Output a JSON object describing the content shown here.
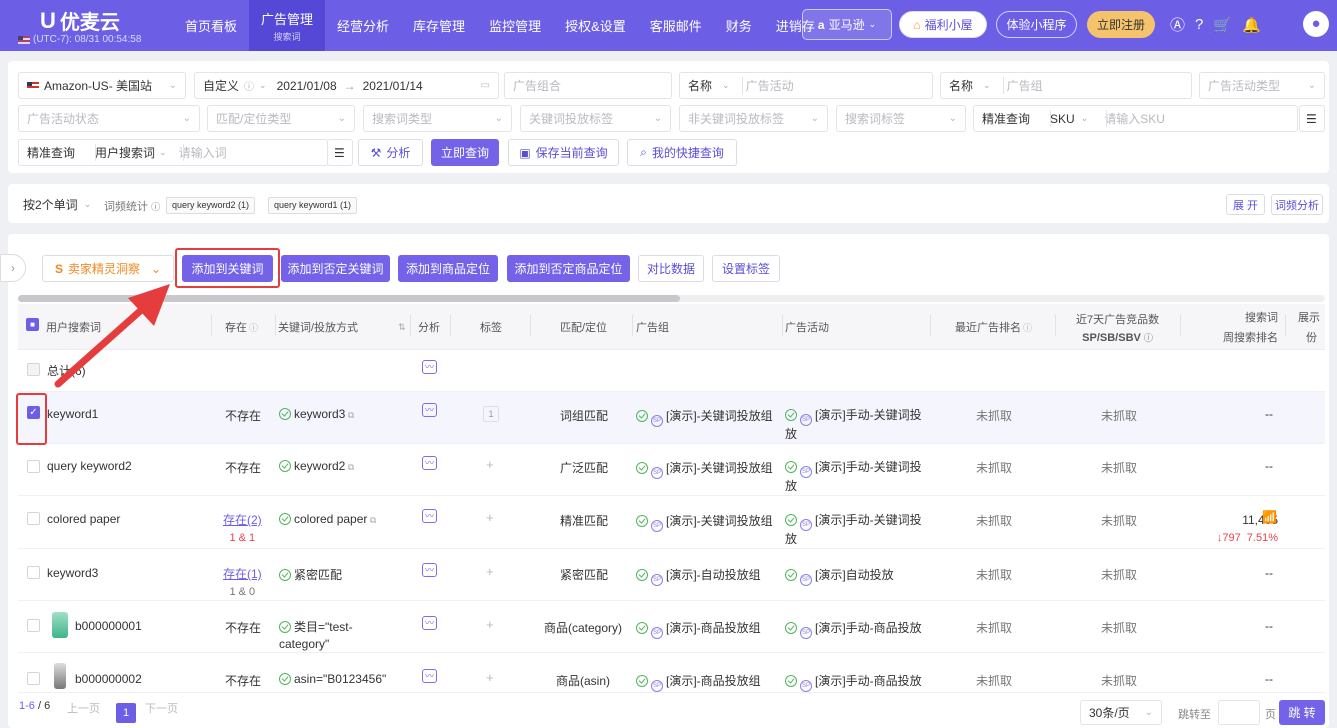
{
  "app": {
    "logo": "优麦云",
    "timezone": "(UTC-7): 08/31 00:54:58"
  },
  "nav": [
    {
      "label": "首页看板",
      "sub": ""
    },
    {
      "label": "广告管理",
      "sub": "搜索词"
    },
    {
      "label": "经营分析",
      "sub": ""
    },
    {
      "label": "库存管理",
      "sub": ""
    },
    {
      "label": "监控管理",
      "sub": ""
    },
    {
      "label": "授权&设置",
      "sub": ""
    },
    {
      "label": "客服邮件",
      "sub": ""
    },
    {
      "label": "财务",
      "sub": ""
    },
    {
      "label": "进销存",
      "sub": ""
    }
  ],
  "topright": {
    "platform": "亚马逊",
    "fuli": "福利小屋",
    "tiyan": "体验小程序",
    "register": "立即注册"
  },
  "filters": {
    "site": "Amazon-US- 美国站",
    "date_mode": "自定义",
    "date_start": "2021/01/08",
    "date_end": "2021/01/14",
    "ad_combo": "广告组合",
    "name1": "名称",
    "ad_campaign": "广告活动",
    "name2": "名称",
    "ad_group": "广告组",
    "campaign_type": "广告活动类型",
    "campaign_status": "广告活动状态",
    "match_type": "匹配/定位类型",
    "search_term_type": "搜索词类型",
    "kw_tag": "关键词投放标签",
    "non_kw_tag": "非关键词投放标签",
    "st_tag": "搜索词标签",
    "exact1": "精准查询",
    "sku": "SKU",
    "sku_placeholder": "请输入SKU",
    "exact2": "精准查询",
    "user_st": "用户搜索词",
    "term_placeholder": "请输入词",
    "analyze": "分析",
    "query_now": "立即查询",
    "save_query": "保存当前查询",
    "my_query": "我的快捷查询"
  },
  "wordstats": {
    "group_by": "按2个单词",
    "label": "词频统计",
    "tags": [
      "query keyword2 (1)",
      "query keyword1 (1)"
    ],
    "expand": "展 开",
    "analysis": "词频分析"
  },
  "actions": {
    "insight": "卖家精灵洞察",
    "add_kw": "添加到关键词",
    "add_neg_kw": "添加到否定关键词",
    "add_product": "添加到商品定位",
    "add_neg_product": "添加到否定商品定位",
    "compare": "对比数据",
    "set_tag": "设置标签"
  },
  "columns": {
    "term": "用户搜索词",
    "exists": "存在",
    "kw": "关键词/投放方式",
    "analysis": "分析",
    "tag": "标签",
    "match": "匹配/定位",
    "adgroup": "广告组",
    "campaign": "广告活动",
    "rank": "最近广告排名",
    "comp_a": "近7天广告竞品数",
    "comp_b": "SP/SB/SBV",
    "weekly_a": "搜索词",
    "weekly_b": "周搜索排名",
    "show_a": "展示",
    "show_b": "份"
  },
  "total_label": "总计(6)",
  "rows": [
    {
      "term": "keyword1",
      "exists": "不存在",
      "exists_sub": "",
      "kw": "keyword3",
      "tag": "1",
      "match": "词组匹配",
      "adgroup": "[演示]-关键词投放组",
      "campaign_1": "[演示]手动-关键词投",
      "campaign_2": "放",
      "rank": "未抓取",
      "comp": "未抓取",
      "weekly": "--",
      "weekly_sub": ""
    },
    {
      "term": "query keyword2",
      "exists": "不存在",
      "exists_sub": "",
      "kw": "keyword2",
      "tag": "+",
      "match": "广泛匹配",
      "adgroup": "[演示]-关键词投放组",
      "campaign_1": "[演示]手动-关键词投",
      "campaign_2": "放",
      "rank": "未抓取",
      "comp": "未抓取",
      "weekly": "--",
      "weekly_sub": ""
    },
    {
      "term": "colored paper",
      "exists": "存在(2)",
      "exists_sub": "1 & 1",
      "kw": "colored paper",
      "tag": "+",
      "match": "精准匹配",
      "adgroup": "[演示]-关键词投放组",
      "campaign_1": "[演示]手动-关键词投",
      "campaign_2": "放",
      "rank": "未抓取",
      "comp": "未抓取",
      "weekly": "11,405",
      "weekly_sub": "↓797  7.51%"
    },
    {
      "term": "keyword3",
      "exists": "存在(1)",
      "exists_sub": "1 & 0",
      "kw": "紧密匹配",
      "tag": "+",
      "match": "紧密匹配",
      "adgroup": "[演示]-自动投放组",
      "campaign_1": "[演示]自动投放",
      "campaign_2": "",
      "rank": "未抓取",
      "comp": "未抓取",
      "weekly": "--",
      "weekly_sub": ""
    },
    {
      "term": "b000000001",
      "exists": "不存在",
      "exists_sub": "",
      "kw": "类目=\"test-",
      "kw2": "category\"",
      "tag": "+",
      "match": "商品(category)",
      "adgroup": "[演示]-商品投放组",
      "campaign_1": "[演示]手动-商品投放",
      "campaign_2": "",
      "rank": "未抓取",
      "comp": "未抓取",
      "weekly": "--",
      "weekly_sub": ""
    },
    {
      "term": "b000000002",
      "exists": "不存在",
      "exists_sub": "",
      "kw": "asin=\"B0123456\"",
      "tag": "+",
      "match": "商品(asin)",
      "adgroup": "[演示]-商品投放组",
      "campaign_1": "[演示]手动-商品投放",
      "campaign_2": "",
      "rank": "未抓取",
      "comp": "未抓取",
      "weekly": "--",
      "weekly_sub": ""
    }
  ],
  "pager": {
    "range": "1-6",
    "total": "/ 6",
    "prev": "上一页",
    "page": "1",
    "next": "下一页",
    "size": "30条/页",
    "goto": "跳转至",
    "page_unit": "页",
    "jump": "跳 转"
  }
}
